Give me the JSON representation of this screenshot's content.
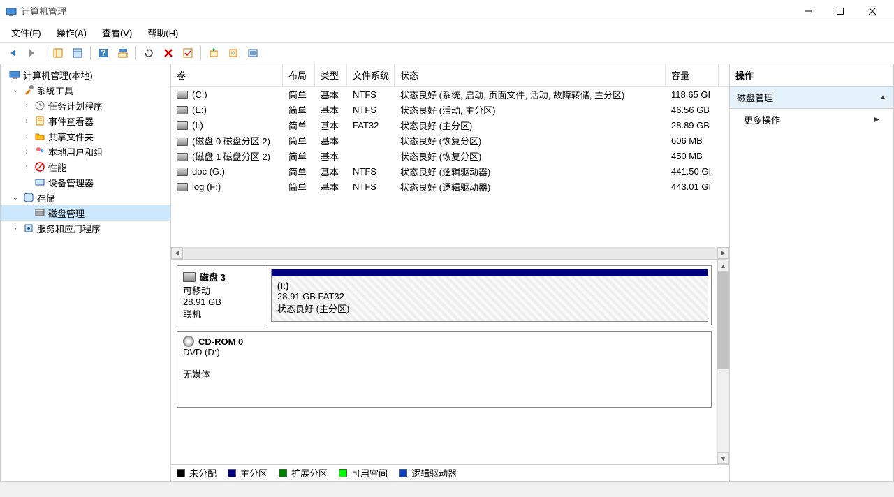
{
  "window": {
    "title": "计算机管理"
  },
  "menubar": [
    "文件(F)",
    "操作(A)",
    "查看(V)",
    "帮助(H)"
  ],
  "tree": {
    "root": "计算机管理(本地)",
    "systools": "系统工具",
    "systools_items": [
      "任务计划程序",
      "事件查看器",
      "共享文件夹",
      "本地用户和组",
      "性能",
      "设备管理器"
    ],
    "storage": "存储",
    "diskmgmt": "磁盘管理",
    "services": "服务和应用程序"
  },
  "columns": {
    "volume": "卷",
    "layout": "布局",
    "type": "类型",
    "fs": "文件系统",
    "status": "状态",
    "capacity": "容量"
  },
  "volumes": [
    {
      "name": "(C:)",
      "layout": "简单",
      "type": "基本",
      "fs": "NTFS",
      "status": "状态良好 (系统, 启动, 页面文件, 活动, 故障转储, 主分区)",
      "cap": "118.65 GI"
    },
    {
      "name": "(E:)",
      "layout": "简单",
      "type": "基本",
      "fs": "NTFS",
      "status": "状态良好 (活动, 主分区)",
      "cap": "46.56 GB"
    },
    {
      "name": "(I:)",
      "layout": "简单",
      "type": "基本",
      "fs": "FAT32",
      "status": "状态良好 (主分区)",
      "cap": "28.89 GB"
    },
    {
      "name": "(磁盘 0 磁盘分区 2)",
      "layout": "简单",
      "type": "基本",
      "fs": "",
      "status": "状态良好 (恢复分区)",
      "cap": "606 MB"
    },
    {
      "name": "(磁盘 1 磁盘分区 2)",
      "layout": "简单",
      "type": "基本",
      "fs": "",
      "status": "状态良好 (恢复分区)",
      "cap": "450 MB"
    },
    {
      "name": "doc (G:)",
      "layout": "简单",
      "type": "基本",
      "fs": "NTFS",
      "status": "状态良好 (逻辑驱动器)",
      "cap": "441.50 GI"
    },
    {
      "name": "log (F:)",
      "layout": "简单",
      "type": "基本",
      "fs": "NTFS",
      "status": "状态良好 (逻辑驱动器)",
      "cap": "443.01 GI"
    }
  ],
  "disks": {
    "disk3": {
      "title": "磁盘 3",
      "l1": "可移动",
      "l2": "28.91 GB",
      "l3": "联机",
      "part": {
        "name": "(I:)",
        "size": "28.91 GB FAT32",
        "status": "状态良好 (主分区)"
      }
    },
    "cdrom": {
      "title": "CD-ROM 0",
      "l1": "DVD (D:)",
      "l2": "无媒体"
    }
  },
  "legend": {
    "unalloc": "未分配",
    "primary": "主分区",
    "extended": "扩展分区",
    "free": "可用空间",
    "logical": "逻辑驱动器"
  },
  "actions": {
    "header": "操作",
    "diskmgmt": "磁盘管理",
    "more": "更多操作"
  }
}
